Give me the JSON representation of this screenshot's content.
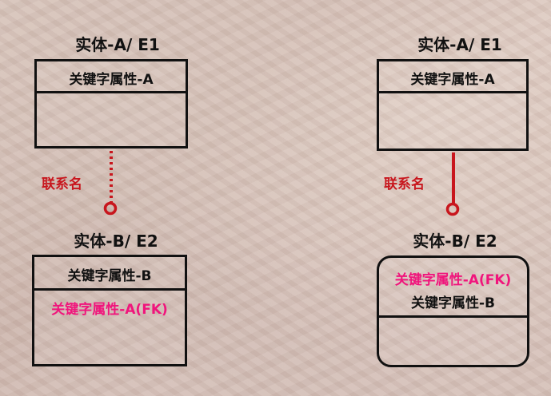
{
  "left": {
    "entity_a": {
      "title": "实体-A/ E1",
      "key_attr": "关键字属性-A"
    },
    "relation_label": "联系名",
    "entity_b": {
      "title": "实体-B/ E2",
      "key_attr": "关键字属性-B",
      "fk_attr": "关键字属性-A(FK)"
    }
  },
  "right": {
    "entity_a": {
      "title": "实体-A/ E1",
      "key_attr": "关键字属性-A"
    },
    "relation_label": "联系名",
    "entity_b": {
      "title": "实体-B/ E2",
      "fk_attr": "关键字属性-A(FK)",
      "key_attr": "关键字属性-B"
    }
  },
  "colors": {
    "line": "#111111",
    "relation": "#c8161d",
    "fk": "#f0157c"
  }
}
